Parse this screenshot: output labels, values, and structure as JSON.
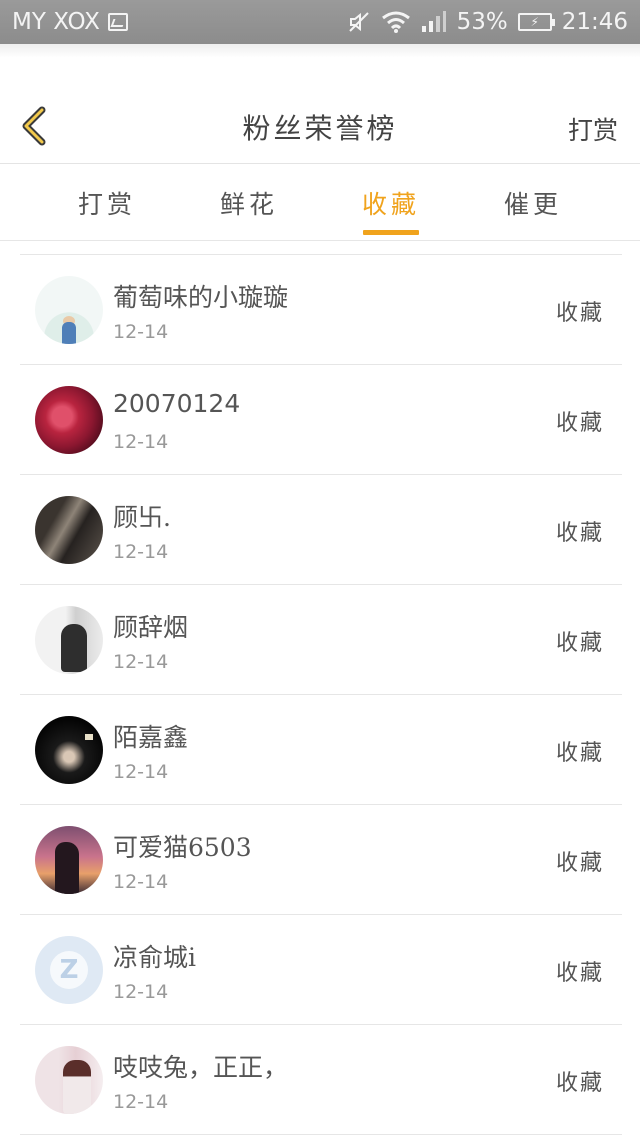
{
  "status_bar": {
    "carrier": "MY XOX",
    "battery": "53%",
    "time": "21:46",
    "icons": [
      "gallery-icon",
      "mute-icon",
      "wifi-icon",
      "signal-icon",
      "battery-icon"
    ]
  },
  "header": {
    "title": "粉丝荣誉榜",
    "right_link": "打赏",
    "back_icon": "chevron-left-icon",
    "accent_color": "#f0a31d"
  },
  "tabs": [
    {
      "label": "打赏",
      "active": false
    },
    {
      "label": "鲜花",
      "active": false
    },
    {
      "label": "收藏",
      "active": true
    },
    {
      "label": "催更",
      "active": false
    }
  ],
  "list": [
    {
      "name": "葡萄味的小璇璇",
      "date": "12-14",
      "action": "收藏"
    },
    {
      "name": "20070124",
      "date": "12-14",
      "action": "收藏"
    },
    {
      "name": "顾卐.",
      "date": "12-14",
      "action": "收藏"
    },
    {
      "name": "顾辞烟",
      "date": "12-14",
      "action": "收藏"
    },
    {
      "name": "陌嘉鑫",
      "date": "12-14",
      "action": "收藏"
    },
    {
      "name": "可爱猫6503",
      "date": "12-14",
      "action": "收藏"
    },
    {
      "name": "凉俞城i",
      "date": "12-14",
      "action": "收藏"
    },
    {
      "name": "吱吱兔，正正，",
      "date": "12-14",
      "action": "收藏"
    }
  ]
}
